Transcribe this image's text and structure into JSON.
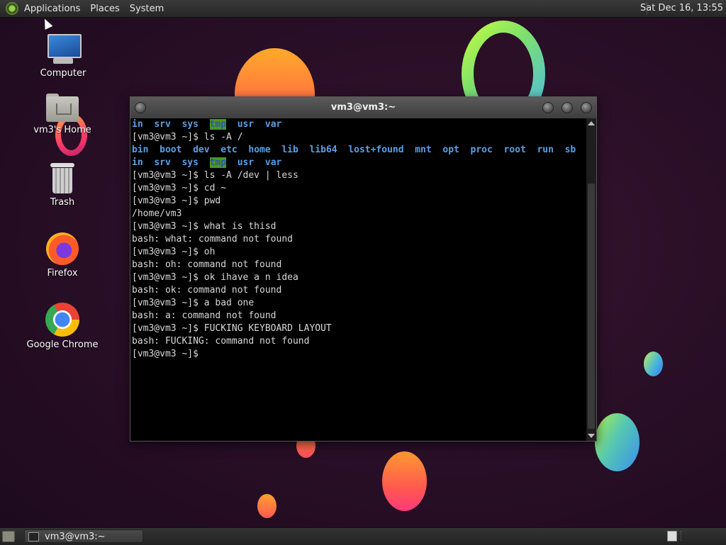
{
  "top_panel": {
    "menus": [
      "Applications",
      "Places",
      "System"
    ],
    "clock": "Sat Dec 16, 13:55"
  },
  "desktop_icons": [
    {
      "label": "Computer",
      "icon": "computer-icon"
    },
    {
      "label": "vm3's Home",
      "icon": "home-folder-icon"
    },
    {
      "label": "Trash",
      "icon": "trash-icon"
    },
    {
      "label": "Firefox",
      "icon": "firefox-icon"
    },
    {
      "label": "Google Chrome",
      "icon": "chrome-icon"
    }
  ],
  "terminal": {
    "title": "vm3@vm3:~",
    "lines": [
      {
        "type": "dirs",
        "items": [
          "in",
          "srv",
          "sys",
          "tmp",
          "usr",
          "var"
        ]
      },
      {
        "type": "text",
        "text": "[vm3@vm3 ~]$ ls -A /"
      },
      {
        "type": "dirs",
        "items": [
          "bin",
          "boot",
          "dev",
          "etc",
          "home",
          "lib",
          "lib64",
          "lost+found",
          "mnt",
          "opt",
          "proc",
          "root",
          "run",
          "sb"
        ]
      },
      {
        "type": "dirs",
        "items": [
          "in",
          "srv",
          "sys",
          "tmp",
          "usr",
          "var"
        ]
      },
      {
        "type": "text",
        "text": "[vm3@vm3 ~]$ ls -A /dev | less"
      },
      {
        "type": "text",
        "text": "[vm3@vm3 ~]$ cd ~"
      },
      {
        "type": "text",
        "text": "[vm3@vm3 ~]$ pwd"
      },
      {
        "type": "text",
        "text": "/home/vm3"
      },
      {
        "type": "text",
        "text": "[vm3@vm3 ~]$ what is thisd"
      },
      {
        "type": "text",
        "text": "bash: what: command not found"
      },
      {
        "type": "text",
        "text": "[vm3@vm3 ~]$ oh"
      },
      {
        "type": "text",
        "text": "bash: oh: command not found"
      },
      {
        "type": "text",
        "text": "[vm3@vm3 ~]$ ok ihave a n idea"
      },
      {
        "type": "text",
        "text": "bash: ok: command not found"
      },
      {
        "type": "text",
        "text": "[vm3@vm3 ~]$ a bad one"
      },
      {
        "type": "text",
        "text": "bash: a: command not found"
      },
      {
        "type": "text",
        "text": "[vm3@vm3 ~]$ FUCKING KEYBOARD LAYOUT"
      },
      {
        "type": "text",
        "text": "bash: FUCKING: command not found"
      },
      {
        "type": "text",
        "text": "[vm3@vm3 ~]$ "
      }
    ],
    "highlight_dir": "tmp"
  },
  "taskbar": {
    "task_label": "vm3@vm3:~"
  },
  "colors": {
    "dir_blue": "#5aa0e6",
    "tmp_highlight": "#4a9a1e",
    "terminal_bg": "#000000",
    "text": "#d8d8d8"
  }
}
